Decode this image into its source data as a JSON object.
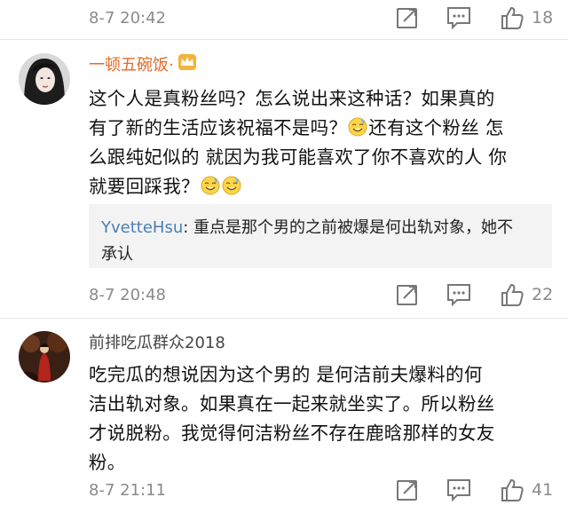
{
  "comments": [
    {
      "time": "8-7 20:42",
      "likes": "18"
    },
    {
      "username": "一顿五碗饭·",
      "text_lines": [
        "这个人是真粉丝吗？怎么说出来这种话？如果真的",
        "有了新的生活应该祝福不是吗？",
        "还有这个粉丝 怎",
        "么跟纯妃似的 就因为我可能喜欢了你不喜欢的人 你",
        "就要回踩我？"
      ],
      "reply_user": "YvetteHsu",
      "reply_text_1": ": 重点是那个男的之前被爆是何出轨对象，她不",
      "reply_text_2": "承认",
      "time": "8-7 20:48",
      "likes": "22"
    },
    {
      "username": "前排吃瓜群众2018",
      "text_lines": [
        "吃完瓜的想说因为这个男的 是何洁前夫爆料的何",
        "洁出轨对象。如果真在一起来就坐实了。所以粉丝",
        "才说脱粉。我觉得何洁粉丝不存在鹿晗那样的女友",
        "粉。"
      ],
      "time": "8-7 21:11",
      "likes": "41"
    }
  ],
  "icons": {
    "share": "share-icon",
    "comment": "comment-icon",
    "like": "thumbs-up-icon",
    "crown": "crown-badge-icon",
    "emoji": "sweat-smile-emoji-icon"
  },
  "colors": {
    "username_vip": "#e46a24",
    "reply_user": "#4a7fb5",
    "meta_gray": "#8a8a8a"
  }
}
